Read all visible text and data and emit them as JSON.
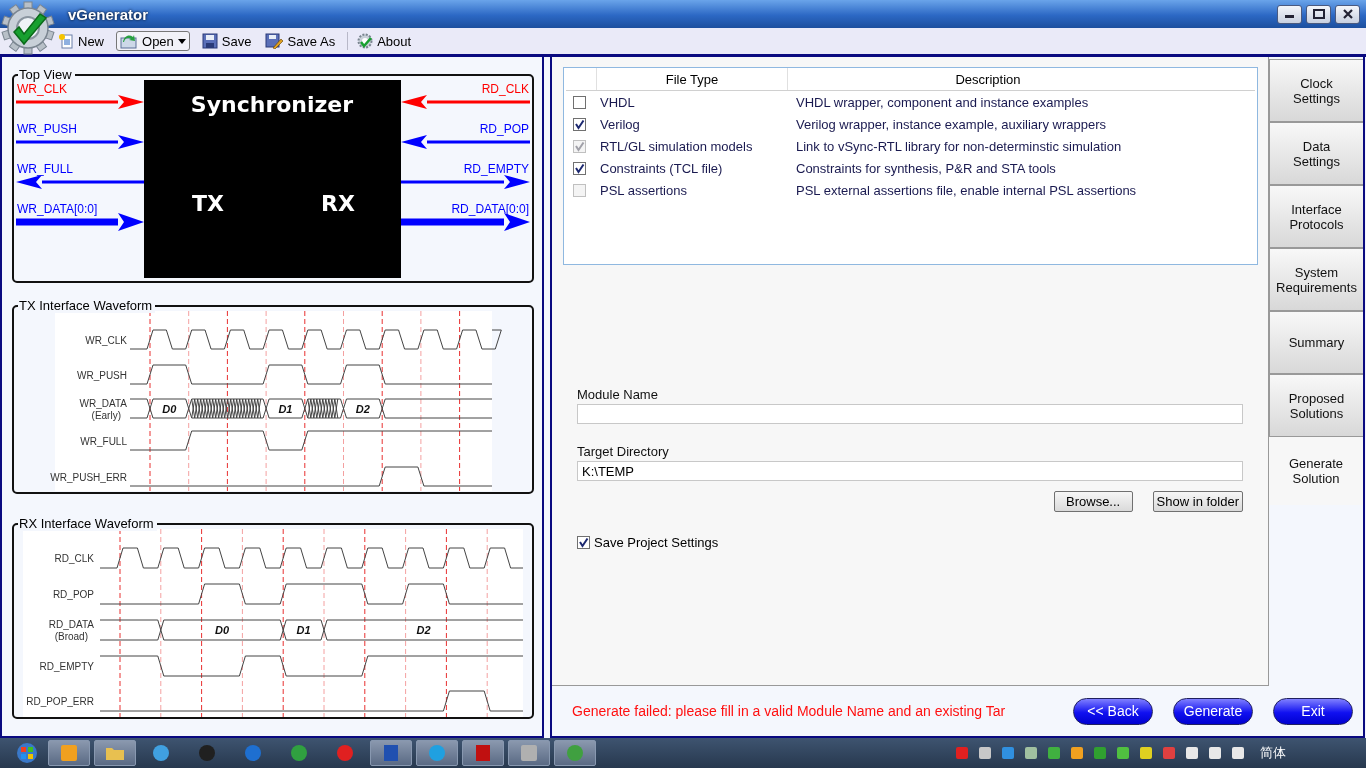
{
  "window": {
    "title": "vGenerator"
  },
  "toolbar": [
    {
      "label": "New",
      "kind": "new",
      "dropdown": false,
      "separated": false
    },
    {
      "label": "Open",
      "kind": "open",
      "dropdown": true,
      "separated": false
    },
    {
      "label": "Save",
      "kind": "save",
      "dropdown": false,
      "separated": false
    },
    {
      "label": "Save As",
      "kind": "save-as",
      "dropdown": false,
      "separated": false
    },
    {
      "label": "About",
      "kind": "about",
      "dropdown": false,
      "separated": true
    }
  ],
  "top_view": {
    "title": "Top View",
    "block": {
      "title": "Synchronizer",
      "left": "TX",
      "right": "RX"
    },
    "left_ports": [
      {
        "label": "WR_CLK",
        "output": false,
        "bus": false,
        "color": "#ff0000"
      },
      {
        "label": "WR_PUSH",
        "output": false,
        "bus": false,
        "color": "#0000ff"
      },
      {
        "label": "WR_FULL",
        "output": true,
        "bus": false,
        "color": "#0000ff"
      },
      {
        "label": "WR_DATA[0:0]",
        "output": false,
        "bus": true,
        "color": "#0000ff"
      }
    ],
    "right_ports": [
      {
        "label": "RD_CLK",
        "output": false,
        "bus": false,
        "color": "#ff0000"
      },
      {
        "label": "RD_POP",
        "output": false,
        "bus": false,
        "color": "#0000ff"
      },
      {
        "label": "RD_EMPTY",
        "output": true,
        "bus": false,
        "color": "#0000ff"
      },
      {
        "label": "RD_DATA[0:0]",
        "output": true,
        "bus": true,
        "color": "#0000ff"
      }
    ]
  },
  "waveforms": [
    {
      "title": "TX Interface Waveform",
      "signals": [
        {
          "name": "WR_CLK",
          "kind": "clock"
        },
        {
          "name": "WR_PUSH",
          "kind": "digital"
        },
        {
          "name": "WR_DATA",
          "note": "(Early)",
          "kind": "bus",
          "data_labels": [
            "D0",
            "D1",
            "D2"
          ]
        },
        {
          "name": "WR_FULL",
          "kind": "digital"
        },
        {
          "name": "WR_PUSH_ERR",
          "kind": "digital"
        }
      ]
    },
    {
      "title": "RX Interface Waveform",
      "signals": [
        {
          "name": "RD_CLK",
          "kind": "clock"
        },
        {
          "name": "RD_POP",
          "kind": "digital"
        },
        {
          "name": "RD_DATA",
          "note": "(Broad)",
          "kind": "bus",
          "data_labels": [
            "D0",
            "D1",
            "D2"
          ]
        },
        {
          "name": "RD_EMPTY",
          "kind": "digital"
        },
        {
          "name": "RD_POP_ERR",
          "kind": "digital"
        }
      ]
    }
  ],
  "file_table": {
    "columns": [
      "File Type",
      "Description"
    ],
    "rows": [
      {
        "file_type": "VHDL",
        "description": "VHDL wrapper, component and instance examples",
        "checked": false,
        "disabled": false
      },
      {
        "file_type": "Verilog",
        "description": "Verilog wrapper, instance example, auxiliary wrappers",
        "checked": true,
        "disabled": false
      },
      {
        "file_type": "RTL/GL simulation models",
        "description": "Link to vSync-RTL library for non-determinstic simulation",
        "checked": true,
        "disabled": true
      },
      {
        "file_type": "Constraints (TCL file)",
        "description": "Constraints for synthesis, P&R and STA tools",
        "checked": true,
        "disabled": false
      },
      {
        "file_type": "PSL assertions",
        "description": "PSL external assertions file, enable internal PSL assertions",
        "checked": false,
        "disabled": true
      }
    ]
  },
  "form": {
    "module_name": {
      "label": "Module Name"
    },
    "target_directory": {
      "label": "Target Directory",
      "value": "K:\\TEMP"
    },
    "buttons": [
      "Browse...",
      "Show in folder"
    ],
    "save_settings": {
      "label": "Save Project Settings",
      "checked": true
    }
  },
  "tabs": [
    {
      "label": "Clock Settings",
      "selected": false
    },
    {
      "label": "Data Settings",
      "selected": false
    },
    {
      "label": "Interface Protocols",
      "selected": false
    },
    {
      "label": "System Requirements",
      "selected": false
    },
    {
      "label": "Summary",
      "selected": false
    },
    {
      "label": "Proposed Solutions",
      "selected": false
    },
    {
      "label": "Generate Solution",
      "selected": true
    }
  ],
  "status": {
    "message": "Generate failed: please fill in a valid Module Name and an existing Tar",
    "buttons": [
      "<< Back",
      "Generate",
      "Exit"
    ]
  },
  "taskbar": {
    "items": [
      {
        "kind": "square",
        "color": "#f0a020",
        "running": true
      },
      {
        "kind": "folder",
        "color": "#e8c050",
        "running": true
      },
      {
        "kind": "circle",
        "color": "#40a0e0",
        "running": false
      },
      {
        "kind": "circle",
        "color": "#202020",
        "running": false
      },
      {
        "kind": "circle",
        "color": "#1e6fd0",
        "running": false
      },
      {
        "kind": "circle",
        "color": "#30a040",
        "running": false
      },
      {
        "kind": "circle",
        "color": "#e02020",
        "running": false
      },
      {
        "kind": "document",
        "color": "#2050b0",
        "running": true
      },
      {
        "kind": "circle",
        "color": "#20a0e0",
        "running": true
      },
      {
        "kind": "document",
        "color": "#c01010",
        "running": true
      },
      {
        "kind": "square",
        "color": "#b0b0b0",
        "running": true
      },
      {
        "kind": "circle",
        "color": "#40a040",
        "running": true
      }
    ],
    "language": "简体"
  }
}
